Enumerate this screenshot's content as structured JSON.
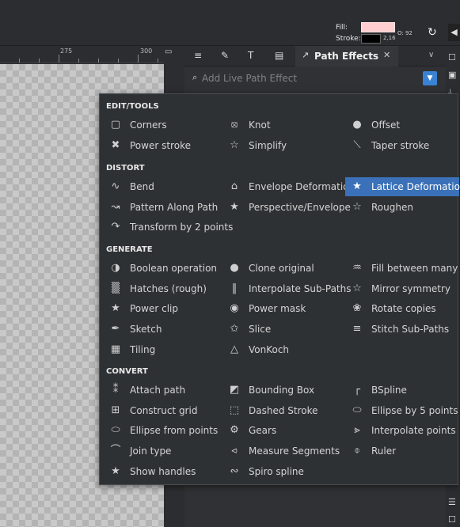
{
  "style_indicator": {
    "fill_label": "Fill:",
    "stroke_label": "Stroke:",
    "stroke_width": "2,16",
    "opacity": "O: 92",
    "fill_color": "#ffcfcf",
    "stroke_color": "#000000"
  },
  "ruler": {
    "ticks": [
      "275",
      "300"
    ]
  },
  "dock": {
    "active_tab_label": "Path Effects",
    "search_placeholder": "Add Live Path Effect"
  },
  "accent_color": "#3a71b8",
  "popup": {
    "sections": [
      {
        "title": "EDIT/TOOLS",
        "items": [
          {
            "label": "Corners",
            "icon": "corners-icon"
          },
          {
            "label": "Knot",
            "icon": "knot-icon"
          },
          {
            "label": "Offset",
            "icon": "offset-icon"
          },
          {
            "label": "Power stroke",
            "icon": "power-stroke-icon"
          },
          {
            "label": "Simplify",
            "icon": "simplify-icon"
          },
          {
            "label": "Taper stroke",
            "icon": "taper-stroke-icon"
          }
        ]
      },
      {
        "title": "DISTORT",
        "items": [
          {
            "label": "Bend",
            "icon": "bend-icon"
          },
          {
            "label": "Envelope Deformation",
            "icon": "envelope-icon"
          },
          {
            "label": "Lattice Deformation",
            "icon": "lattice-icon",
            "selected": true
          },
          {
            "label": "Pattern Along Path",
            "icon": "pattern-icon"
          },
          {
            "label": "Perspective/Envelope",
            "icon": "perspective-icon"
          },
          {
            "label": "Roughen",
            "icon": "roughen-icon"
          },
          {
            "label": "Transform by 2 points",
            "icon": "transform-icon"
          }
        ]
      },
      {
        "title": "GENERATE",
        "items": [
          {
            "label": "Boolean operation",
            "icon": "boolean-icon"
          },
          {
            "label": "Clone original",
            "icon": "clone-icon"
          },
          {
            "label": "Fill between many",
            "icon": "fill-between-icon"
          },
          {
            "label": "Hatches (rough)",
            "icon": "hatches-icon"
          },
          {
            "label": "Interpolate Sub-Paths",
            "icon": "interpolate-subpaths-icon"
          },
          {
            "label": "Mirror symmetry",
            "icon": "mirror-icon"
          },
          {
            "label": "Power clip",
            "icon": "power-clip-icon"
          },
          {
            "label": "Power mask",
            "icon": "power-mask-icon"
          },
          {
            "label": "Rotate copies",
            "icon": "rotate-copies-icon"
          },
          {
            "label": "Sketch",
            "icon": "sketch-icon"
          },
          {
            "label": "Slice",
            "icon": "slice-icon"
          },
          {
            "label": "Stitch Sub-Paths",
            "icon": "stitch-icon"
          },
          {
            "label": "Tiling",
            "icon": "tiling-icon"
          },
          {
            "label": "VonKoch",
            "icon": "vonkoch-icon"
          }
        ]
      },
      {
        "title": "CONVERT",
        "items": [
          {
            "label": "Attach path",
            "icon": "attach-path-icon"
          },
          {
            "label": "Bounding Box",
            "icon": "bounding-box-icon"
          },
          {
            "label": "BSpline",
            "icon": "bspline-icon"
          },
          {
            "label": "Construct grid",
            "icon": "construct-grid-icon"
          },
          {
            "label": "Dashed Stroke",
            "icon": "dashed-stroke-icon"
          },
          {
            "label": "Ellipse by 5 points",
            "icon": "ellipse-5-icon"
          },
          {
            "label": "Ellipse from points",
            "icon": "ellipse-points-icon"
          },
          {
            "label": "Gears",
            "icon": "gears-icon"
          },
          {
            "label": "Interpolate points",
            "icon": "interpolate-points-icon"
          },
          {
            "label": "Join type",
            "icon": "join-type-icon"
          },
          {
            "label": "Measure Segments",
            "icon": "measure-icon"
          },
          {
            "label": "Ruler",
            "icon": "ruler-icon"
          },
          {
            "label": "Show handles",
            "icon": "show-handles-icon"
          },
          {
            "label": "Spiro spline",
            "icon": "spiro-icon"
          }
        ]
      }
    ]
  }
}
